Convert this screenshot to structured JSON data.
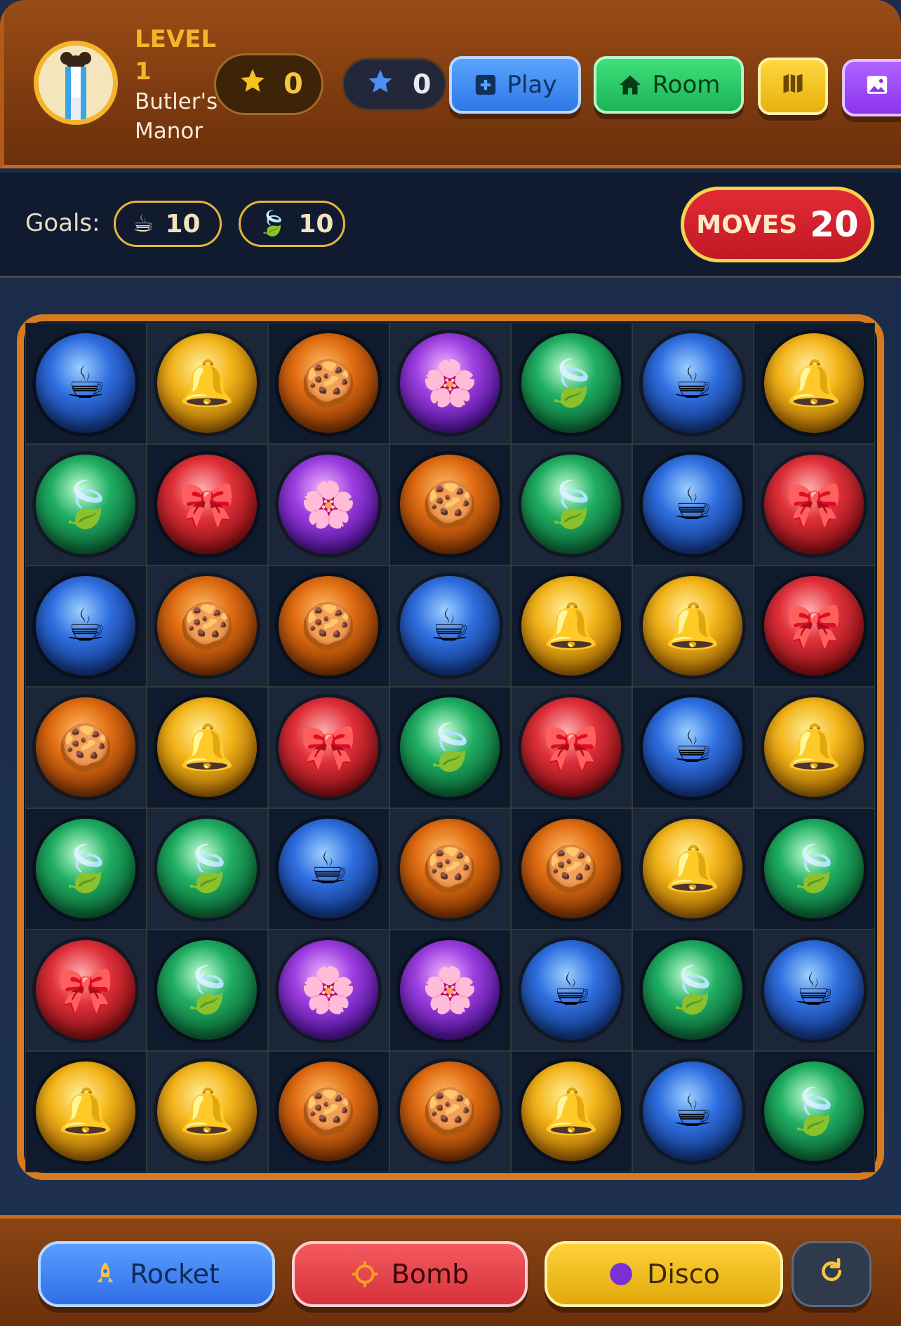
{
  "header": {
    "level_label": "LEVEL",
    "level_number": "1",
    "level_name": "Butler's Manor",
    "score": "0",
    "stars": "0",
    "buttons": {
      "play": "Play",
      "room": "Room"
    }
  },
  "goals": {
    "label": "Goals:",
    "items": [
      {
        "icon": "☕",
        "count": "10"
      },
      {
        "icon": "🍃",
        "count": "10"
      }
    ],
    "moves_label": "MOVES",
    "moves_value": "20"
  },
  "board": {
    "rows": [
      [
        "coffee",
        "bell",
        "cookie",
        "flower",
        "leaf",
        "coffee",
        "bell"
      ],
      [
        "leaf",
        "bow",
        "flower",
        "cookie",
        "leaf",
        "coffee",
        "bow"
      ],
      [
        "coffee",
        "cookie",
        "cookie",
        "coffee",
        "bell",
        "bell",
        "bow"
      ],
      [
        "cookie",
        "bell",
        "bow",
        "leaf",
        "bow",
        "coffee",
        "bell"
      ],
      [
        "leaf",
        "leaf",
        "coffee",
        "cookie",
        "cookie",
        "bell",
        "leaf"
      ],
      [
        "bow",
        "leaf",
        "flower",
        "flower",
        "coffee",
        "leaf",
        "coffee"
      ],
      [
        "bell",
        "bell",
        "cookie",
        "cookie",
        "bell",
        "coffee",
        "leaf"
      ]
    ],
    "glyphs": {
      "coffee": "☕",
      "bell": "🔔",
      "cookie": "🍪",
      "flower": "🌸",
      "leaf": "🍃",
      "bow": "🎀"
    }
  },
  "footer": {
    "rocket": "Rocket",
    "bomb": "Bomb",
    "disco": "Disco"
  },
  "colors": {
    "header_brown": "#8a4514",
    "board_border": "#d87b1f",
    "moves_red": "#d6262f",
    "gold": "#f5b52a"
  }
}
